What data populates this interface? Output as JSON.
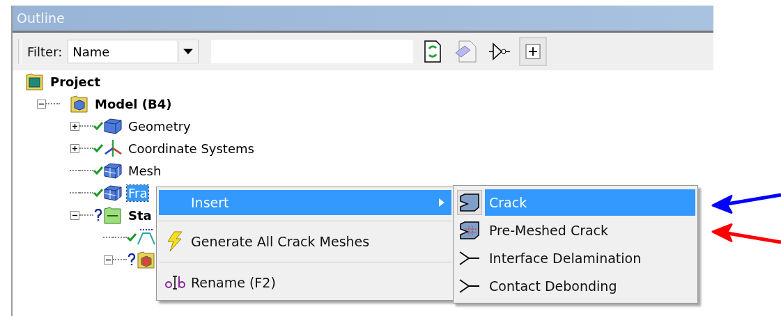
{
  "window": {
    "title": "Outline"
  },
  "toolbar": {
    "filter_label": "Filter:",
    "filter_select": {
      "value": "Name"
    },
    "buttons": [
      {
        "kind": "refresh",
        "pressed": false
      },
      {
        "kind": "eraser",
        "pressed": false
      },
      {
        "kind": "gate",
        "pressed": false
      },
      {
        "kind": "expand",
        "pressed": true
      }
    ]
  },
  "tree": [
    {
      "label": "Project",
      "bold": true,
      "kind": "project",
      "selected": false,
      "children": [
        {
          "label": "Model (B4)",
          "bold": true,
          "expanded": true,
          "kind": "model",
          "selected": false,
          "children": [
            {
              "label": "Geometry",
              "bold": false,
              "expanded": false,
              "solved": true,
              "kind": "geometry",
              "selected": false
            },
            {
              "label": "Coordinate Systems",
              "bold": false,
              "expanded": false,
              "solved": true,
              "kind": "axes",
              "selected": false
            },
            {
              "label": "Mesh",
              "bold": false,
              "solved": true,
              "kind": "mesh",
              "selected": false
            },
            {
              "label": "Fra",
              "bold": false,
              "solved": true,
              "kind": "mesh",
              "selected": true
            },
            {
              "label": "Sta",
              "bold": true,
              "expanded": true,
              "solved": false,
              "kind": "analysis",
              "selected": false,
              "children": [
                {
                  "solved": true,
                  "kind": "settings"
                },
                {
                  "expanded": true,
                  "solved": false,
                  "kind": "solution"
                }
              ]
            }
          ]
        }
      ]
    }
  ],
  "context_menu": {
    "items": [
      {
        "kind": "submenu",
        "label": "Insert",
        "selected": true
      },
      {
        "kind": "separator"
      },
      {
        "kind": "generate",
        "label": "Generate All Crack Meshes",
        "selected": false
      },
      {
        "kind": "separator"
      },
      {
        "kind": "rename",
        "label": "Rename (F2)",
        "selected": false
      }
    ]
  },
  "submenu": {
    "items": [
      {
        "label": "Crack",
        "kind": "crack",
        "selected": true
      },
      {
        "label": "Pre-Meshed Crack",
        "kind": "premeshed",
        "selected": false
      },
      {
        "label": "Interface Delamination",
        "kind": "delamination",
        "selected": false
      },
      {
        "label": "Contact Debonding",
        "kind": "delamination",
        "selected": false
      }
    ]
  },
  "annotations": [
    {
      "color": "#0000ff"
    },
    {
      "color": "#ff0000"
    }
  ]
}
